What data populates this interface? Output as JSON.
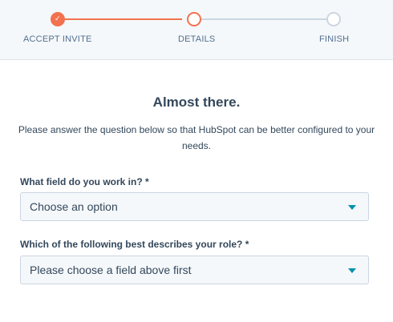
{
  "stepper": {
    "steps": [
      {
        "label": "ACCEPT INVITE",
        "state": "done"
      },
      {
        "label": "DETAILS",
        "state": "active"
      },
      {
        "label": "FINISH",
        "state": "todo"
      }
    ],
    "check_glyph": "✓"
  },
  "form": {
    "title": "Almost there.",
    "subtitle": "Please answer the question below so that HubSpot can be better configured to your needs.",
    "field_work": {
      "label": "What field do you work in? *",
      "value": "Choose an option"
    },
    "field_role": {
      "label": "Which of the following best describes your role? *",
      "value": "Please choose a field above first"
    }
  },
  "colors": {
    "accent": "#f2724f",
    "caret": "#0091ae",
    "text": "#33475b",
    "inactive": "#cbd6e2"
  },
  "icons": {
    "step_done": "check-icon",
    "select_caret": "caret-down-icon"
  }
}
